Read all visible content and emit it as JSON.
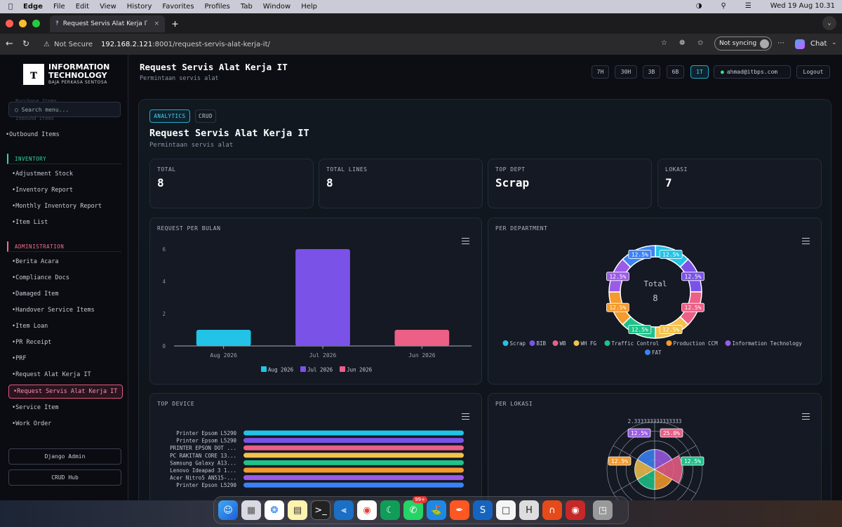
{
  "menubar": {
    "app": "Edge",
    "items": [
      "File",
      "Edit",
      "View",
      "History",
      "Favorites",
      "Profiles",
      "Tab",
      "Window",
      "Help"
    ],
    "datetime": "Wed 19 Aug  10.31"
  },
  "tab": {
    "title": "Request Servis Alat Kerja IT - BP"
  },
  "address": {
    "security": "Not Secure",
    "host": "192.168.2.121",
    "path": ":8001/request-servis-alat-kerja-it/",
    "sync": "Not syncing",
    "chat": "Chat"
  },
  "sidebar": {
    "logo_title_1": "INFORMATION",
    "logo_title_2": "TECHNOLOGY",
    "logo_sub": "BAJA PERKASA SENTOSA",
    "ghost_top": "Purchase Items",
    "ghost_bottom": "Inbound Items",
    "search_placeholder": "Search menu...",
    "outbound": "Outbound Items",
    "inventory_heading": "INVENTORY",
    "inventory_items": [
      "Adjustment Stock",
      "Inventory Report",
      "Monthly Inventory Report",
      "Item List"
    ],
    "admin_heading": "ADMINISTRATION",
    "admin_items": [
      "Berita Acara",
      "Compliance Docs",
      "Damaged Item",
      "Handover Service Items",
      "Item Loan",
      "PR Receipt",
      "PRF",
      "Request Alat Kerja IT"
    ],
    "active_item": "Request Servis Alat Kerja IT",
    "after_items": [
      "Service Item",
      "Work Order"
    ],
    "btn_django": "Django Admin",
    "btn_crud": "CRUD Hub"
  },
  "header": {
    "title": "Request Servis Alat Kerja IT",
    "subtitle": "Permintaan servis alat",
    "ranges": [
      "7H",
      "30H",
      "3B",
      "6B",
      "1T"
    ],
    "active_range": "1T",
    "user": "ahmad@itbps.com",
    "logout": "Logout"
  },
  "panel": {
    "tab_analytics": "ANALYTICS",
    "tab_crud": "CRUD",
    "title": "Request Servis Alat Kerja IT",
    "subtitle": "Permintaan servis alat"
  },
  "stats": [
    {
      "label": "TOTAL",
      "value": "8"
    },
    {
      "label": "TOTAL LINES",
      "value": "8"
    },
    {
      "label": "TOP DEPT",
      "value": "Scrap"
    },
    {
      "label": "LOKASI",
      "value": "7"
    }
  ],
  "colors": {
    "cyan": "#22c3e6",
    "purple": "#7b52e8",
    "pink": "#ec5f86",
    "yellow": "#f2c14e",
    "green": "#1fc28a",
    "orange": "#f59a2c",
    "violet": "#9b5be6",
    "blue": "#3b82f6",
    "active_border": "#e05a7e"
  },
  "chart_data": [
    {
      "type": "bar",
      "title": "REQUEST PER BULAN",
      "categories": [
        "Aug 2026",
        "Jul 2026",
        "Jun 2026"
      ],
      "values": [
        1,
        6,
        1
      ],
      "colors": [
        "#22c3e6",
        "#7b52e8",
        "#ec5f86"
      ],
      "yticks": [
        "0",
        "2",
        "4",
        "6"
      ],
      "ylim": [
        0,
        6
      ],
      "legend": [
        "Aug 2026",
        "Jul 2026",
        "Jun 2026"
      ],
      "legend_position": "bottom"
    },
    {
      "type": "pie",
      "title": "PER DEPARTMENT",
      "center_label": "Total",
      "center_value": "8",
      "labels": [
        "Scrap",
        "BIB",
        "WB",
        "WH FG",
        "Traffic Control",
        "Production CCM",
        "Information Technology",
        "FAT"
      ],
      "values": [
        1,
        1,
        1,
        1,
        1,
        1,
        1,
        1
      ],
      "slice_labels": [
        "12.5%",
        "12.5%",
        "12.5%",
        "12.5%",
        "12.5%",
        "12.5%",
        "12.5%",
        "12.5%"
      ],
      "colors": [
        "#22c3e6",
        "#7b52e8",
        "#ec5f86",
        "#f2c14e",
        "#1fc28a",
        "#f59a2c",
        "#9b5be6",
        "#3b82f6"
      ],
      "legend_position": "bottom"
    },
    {
      "type": "bar",
      "title": "TOP DEVICE",
      "orientation": "horizontal",
      "categories": [
        "Printer Epsom L5290",
        "Printer Epsom L5290",
        "PRINTER EPSON DOT ...",
        "PC RAKITAN CORE 13...",
        "Samsung Galaxy A13...",
        "Lenovo Ideapad 3 1...",
        "Acer Nitro5 AN515-...",
        "Printer Epson L5290"
      ],
      "values": [
        1,
        1,
        1,
        1,
        1,
        1,
        1,
        1
      ],
      "colors": [
        "#22c3e6",
        "#7b52e8",
        "#ec5f86",
        "#f2c14e",
        "#1fc28a",
        "#f59a2c",
        "#9b5be6",
        "#3b82f6"
      ]
    },
    {
      "type": "pie",
      "subtype": "polar-area",
      "title": "PER LOKASI",
      "tick_label": "2.333333333333333",
      "slice_labels": [
        "12.5%",
        "25.0%",
        "12.5%",
        "12.5%",
        "12.5%",
        "12.5%"
      ],
      "colors": [
        "#9b5be6",
        "#ec5f86",
        "#f59a2c",
        "#1fc28a",
        "#f2c14e",
        "#3b82f6"
      ]
    }
  ],
  "dock": {
    "badge": "99+"
  }
}
